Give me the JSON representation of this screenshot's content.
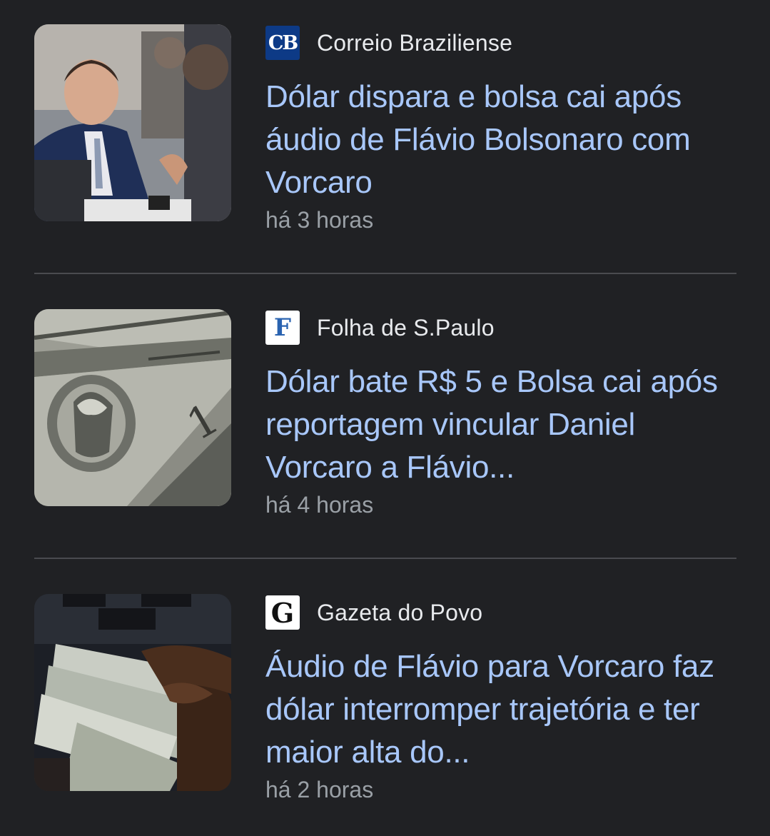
{
  "articles": [
    {
      "source": "Correio Braziliense",
      "logo_text": "CB",
      "headline": "Dólar dispara e bolsa cai após áudio de Flávio Bolsonaro com Vorcaro",
      "time": "há 3 horas"
    },
    {
      "source": "Folha de S.Paulo",
      "logo_text": "F",
      "headline": "Dólar bate R$ 5 e Bolsa cai após reportagem vincular Daniel Vorcaro a Flávio...",
      "time": "há 4 horas"
    },
    {
      "source": "Gazeta do Povo",
      "logo_text": "G",
      "headline": "Áudio de Flávio para Vorcaro faz dólar interromper trajetória e ter maior alta do...",
      "time": "há 2 horas"
    }
  ],
  "colors": {
    "background": "#202124",
    "headline": "#a8c7fa",
    "source": "#e8eaed",
    "timestamp": "#9aa0a6",
    "divider": "#4a4b4f"
  }
}
